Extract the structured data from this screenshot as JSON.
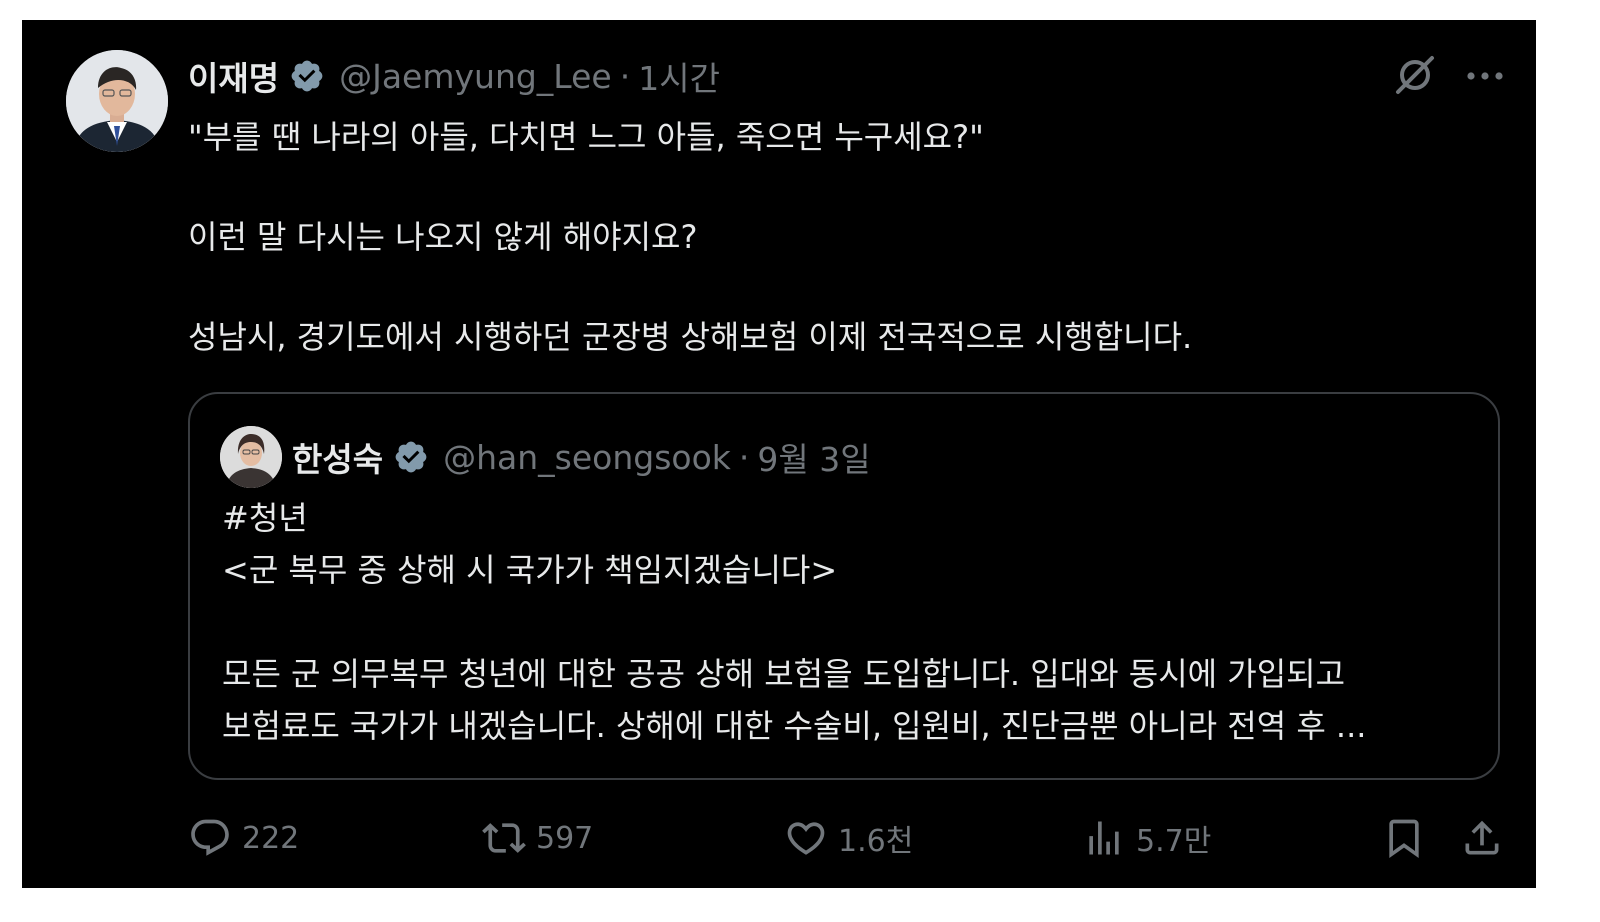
{
  "tweet": {
    "author": {
      "display_name": "이재명",
      "handle": "@Jaemyung_Lee",
      "verified_icon": "verified-badge-icon"
    },
    "separator": "·",
    "time": "1시간",
    "text_lines": [
      "\"부를 땐 나라의 아들, 다치면 느그 아들, 죽으면 누구세요?\"",
      "이런 말 다시는 나오지 않게 해야지요?",
      "성남시, 경기도에서 시행하던 군장병 상해보험 이제 전국적으로 시행합니다."
    ],
    "header_icons": [
      "grok-icon",
      "more-options-icon"
    ]
  },
  "quote": {
    "author": {
      "display_name": "한성숙",
      "handle": "@han_seongsook",
      "verified_icon": "verified-badge-icon"
    },
    "separator": "·",
    "time": "9월 3일",
    "text_lines": [
      "#청년",
      "<군 복무 중 상해 시 국가가 책임지겠습니다>",
      "모든 군 의무복무 청년에 대한 공공 상해 보험을 도입합니다. 입대와 동시에 가입되고",
      "보험료도 국가가 내겠습니다. 상해에 대한 수술비, 입원비, 진단금뿐 아니라 전역 후 ..."
    ]
  },
  "actions": {
    "replies": "222",
    "retweets": "597",
    "likes": "1.6천",
    "views": "5.7만",
    "icons": [
      "reply-icon",
      "retweet-icon",
      "like-icon",
      "views-icon",
      "bookmark-icon",
      "share-icon"
    ]
  },
  "colors": {
    "background": "#000000",
    "text_primary": "#e7e9ea",
    "text_secondary": "#71767b",
    "verified_badge": "#829aab",
    "border": "#3a3d41",
    "page_frame": "#ffffff"
  }
}
